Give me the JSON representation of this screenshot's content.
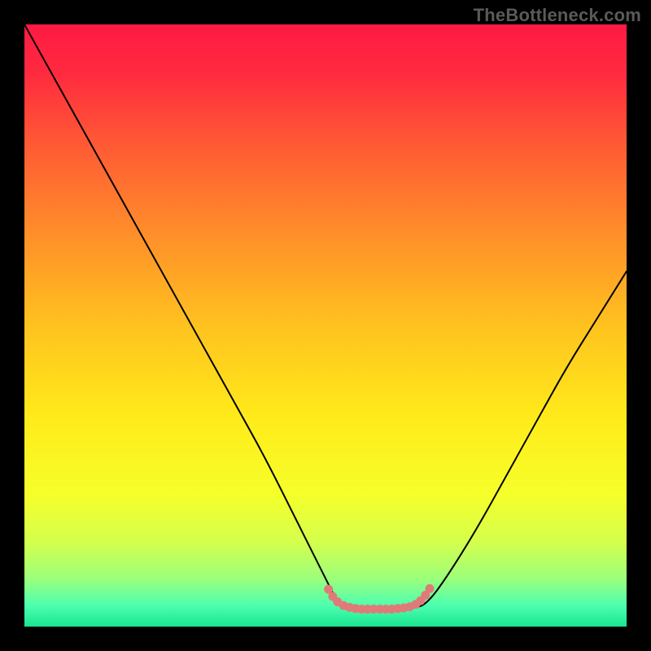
{
  "watermark": "TheBottleneck.com",
  "chart_data": {
    "type": "line",
    "title": "",
    "xlabel": "",
    "ylabel": "",
    "xlim": [
      0,
      100
    ],
    "ylim": [
      0,
      100
    ],
    "background": {
      "stops": [
        {
          "pos": 0.0,
          "color": "#ff1a44"
        },
        {
          "pos": 0.08,
          "color": "#ff2a3f"
        },
        {
          "pos": 0.2,
          "color": "#ff5a34"
        },
        {
          "pos": 0.35,
          "color": "#ff8f2a"
        },
        {
          "pos": 0.5,
          "color": "#ffc21f"
        },
        {
          "pos": 0.65,
          "color": "#ffea1a"
        },
        {
          "pos": 0.78,
          "color": "#f6ff2a"
        },
        {
          "pos": 0.86,
          "color": "#d4ff4d"
        },
        {
          "pos": 0.92,
          "color": "#9cff7a"
        },
        {
          "pos": 0.965,
          "color": "#4dffb0"
        },
        {
          "pos": 1.0,
          "color": "#18e58f"
        }
      ]
    },
    "series": [
      {
        "name": "curve",
        "color": "#000000",
        "width": 2,
        "x": [
          0,
          5,
          10,
          15,
          20,
          25,
          30,
          35,
          40,
          45,
          50,
          52,
          55,
          60,
          65,
          67,
          70,
          75,
          80,
          85,
          90,
          95,
          100
        ],
        "y": [
          100,
          91,
          82,
          73,
          64,
          55,
          46,
          37,
          28,
          18,
          8,
          4,
          3,
          3,
          3,
          4,
          8,
          16,
          25,
          34,
          43,
          51,
          59
        ]
      },
      {
        "name": "dot-band",
        "color": "#e07a78",
        "width": 11,
        "x": [
          50.5,
          51.2,
          52.0,
          53.0,
          54.0,
          55.0,
          56.0,
          57.0,
          58.0,
          59.0,
          60.0,
          61.0,
          62.0,
          63.0,
          64.0,
          65.0,
          65.8,
          66.6,
          67.3
        ],
        "y": [
          6.2,
          5.0,
          4.1,
          3.5,
          3.2,
          3.0,
          2.9,
          2.9,
          2.9,
          2.9,
          2.9,
          2.9,
          3.0,
          3.1,
          3.3,
          3.7,
          4.3,
          5.2,
          6.3
        ]
      }
    ]
  }
}
